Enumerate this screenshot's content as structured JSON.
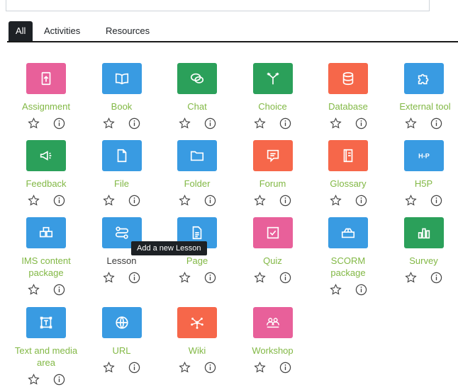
{
  "tabs": [
    "All",
    "Activities",
    "Resources"
  ],
  "tooltip": "Add a new Lesson",
  "colors": {
    "pink": "#e8609a",
    "blue": "#399be2",
    "green": "#2ba05a",
    "orange": "#f6674a",
    "label_green": "#82b845"
  },
  "modules": [
    {
      "label": "Assignment",
      "color": "pink",
      "icon": "assignment-icon"
    },
    {
      "label": "Book",
      "color": "blue",
      "icon": "book-icon"
    },
    {
      "label": "Chat",
      "color": "green",
      "icon": "chat-icon"
    },
    {
      "label": "Choice",
      "color": "green",
      "icon": "choice-icon"
    },
    {
      "label": "Database",
      "color": "orange",
      "icon": "database-icon"
    },
    {
      "label": "External tool",
      "color": "blue",
      "icon": "puzzle-icon"
    },
    {
      "label": "Feedback",
      "color": "green",
      "icon": "megaphone-icon"
    },
    {
      "label": "File",
      "color": "blue",
      "icon": "file-icon"
    },
    {
      "label": "Folder",
      "color": "blue",
      "icon": "folder-icon"
    },
    {
      "label": "Forum",
      "color": "orange",
      "icon": "forum-icon"
    },
    {
      "label": "Glossary",
      "color": "orange",
      "icon": "glossary-icon"
    },
    {
      "label": "H5P",
      "color": "blue",
      "icon": "h5p-icon"
    },
    {
      "label": "IMS content package",
      "color": "blue",
      "icon": "package-icon"
    },
    {
      "label": "Lesson",
      "color": "blue",
      "icon": "lesson-icon"
    },
    {
      "label": "Page",
      "color": "blue",
      "icon": "page-icon"
    },
    {
      "label": "Quiz",
      "color": "pink",
      "icon": "quiz-icon"
    },
    {
      "label": "SCORM package",
      "color": "blue",
      "icon": "scorm-icon"
    },
    {
      "label": "Survey",
      "color": "green",
      "icon": "survey-icon"
    },
    {
      "label": "Text and media area",
      "color": "blue",
      "icon": "text-media-icon"
    },
    {
      "label": "URL",
      "color": "blue",
      "icon": "globe-icon"
    },
    {
      "label": "Wiki",
      "color": "orange",
      "icon": "wiki-icon"
    },
    {
      "label": "Workshop",
      "color": "pink",
      "icon": "workshop-icon"
    }
  ]
}
